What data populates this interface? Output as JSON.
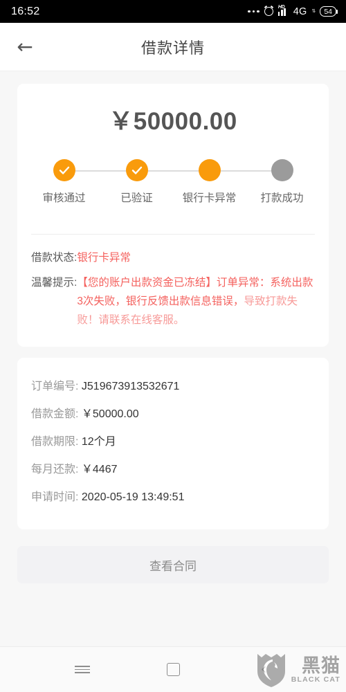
{
  "statusbar": {
    "time": "16:52",
    "network": "4G",
    "battery": "54",
    "hd_label": "HD",
    "icons": [
      "more-dots-icon",
      "alarm-clock-icon",
      "signal-bars-icon",
      "data-arrows-icon",
      "battery-icon"
    ]
  },
  "header": {
    "back_icon": "←",
    "title": "借款详情"
  },
  "loan": {
    "amount": "￥50000.00"
  },
  "stepper": {
    "steps": [
      {
        "label": "审核通过",
        "state": "done",
        "icon": "check-icon"
      },
      {
        "label": "已验证",
        "state": "done",
        "icon": "check-icon"
      },
      {
        "label": "银行卡异常",
        "state": "current",
        "icon": ""
      },
      {
        "label": "打款成功",
        "state": "pending",
        "icon": ""
      }
    ],
    "active_color": "#f99b0c",
    "pending_color": "#9b9b9b"
  },
  "status": {
    "state_label": "借款状态:",
    "state_value": "银行卡异常",
    "tip_label": "温馨提示:",
    "tip_value": "【您的账户出款资金已冻结】订单异常：系统出款3次失败，银行反馈出款信息错误，",
    "tip_value_tail": "导致打款失败！请联系在线客服。",
    "alert_color": "#f4615e"
  },
  "details": {
    "rows": [
      {
        "label": "订单编号:",
        "value": "J519673913532671"
      },
      {
        "label": "借款金额:",
        "value": "￥50000.00"
      },
      {
        "label": "借款期限:",
        "value": "12个月"
      },
      {
        "label": "每月还款:",
        "value": "￥4467"
      },
      {
        "label": "申请时间:",
        "value": "2020-05-19 13:49:51"
      }
    ]
  },
  "actions": {
    "contract_label": "查看合同"
  },
  "navbar": {
    "menu_icon": "menu-icon",
    "home_icon": "home-square-icon",
    "back_icon": "‹"
  },
  "watermark": {
    "cn": "黑猫",
    "en": "BLACK CAT"
  }
}
